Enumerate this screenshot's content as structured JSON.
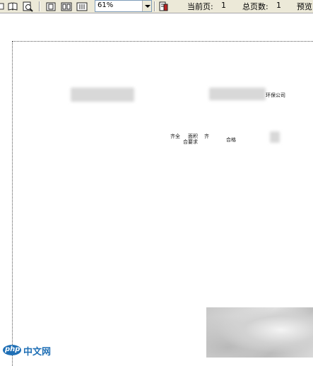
{
  "toolbar": {
    "zoom_value": "61%",
    "current_page_label": "当前页:",
    "current_page_value": "1",
    "total_pages_label": "总页数:",
    "total_pages_value": "1",
    "preview_label": "预览"
  },
  "document": {
    "header_right_text": "环保公司",
    "row_label_left": "齐全",
    "row_label_mid": "面积",
    "row_label_mid2": "齐",
    "row_label_bottom": "合要求",
    "row_label_right": "合格"
  },
  "watermark": {
    "logo_text": "php",
    "site_text": "中文网"
  }
}
